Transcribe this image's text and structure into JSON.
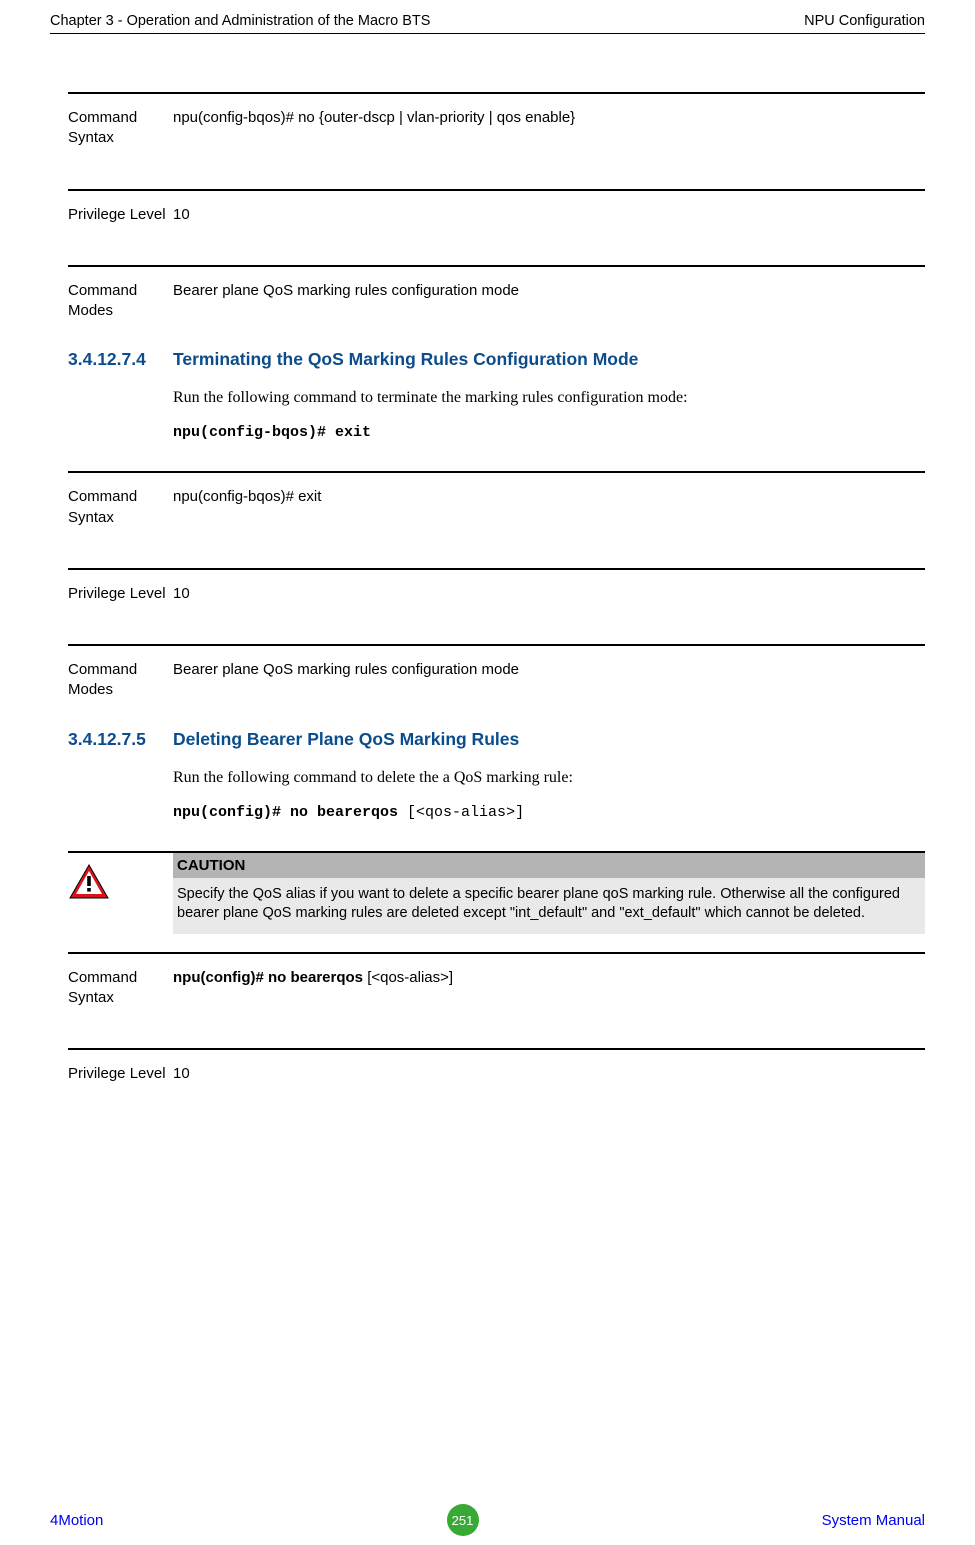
{
  "header": {
    "left": "Chapter 3 - Operation and Administration of the Macro BTS",
    "right": "NPU Configuration"
  },
  "block1": {
    "label": "Command Syntax",
    "value": "npu(config-bqos)# no {outer-dscp | vlan-priority | qos enable}"
  },
  "block2": {
    "label": "Privilege Level",
    "value": "10"
  },
  "block3": {
    "label": "Command Modes",
    "value": "Bearer plane QoS marking rules configuration mode"
  },
  "section1": {
    "num": "3.4.12.7.4",
    "title": "Terminating the QoS Marking Rules Configuration Mode",
    "body": "Run the following command to terminate the marking rules configuration mode:",
    "code": "npu(config-bqos)# exit"
  },
  "block4": {
    "label": "Command Syntax",
    "value": "npu(config-bqos)# exit"
  },
  "block5": {
    "label": "Privilege Level",
    "value": "10"
  },
  "block6": {
    "label": "Command Modes",
    "value": "Bearer plane QoS marking rules configuration mode"
  },
  "section2": {
    "num": "3.4.12.7.5",
    "title": "Deleting Bearer Plane QoS Marking Rules",
    "body": "Run the following command to delete the a QoS marking rule:",
    "code_bold": "npu(config)# no bearerqos ",
    "code_arg": "[<qos-alias>]"
  },
  "caution": {
    "title": "CAUTION",
    "body": "Specify the QoS alias if you want to delete a specific bearer plane qoS marking rule. Otherwise all the configured bearer plane QoS marking rules are deleted except \"int_default\" and \"ext_default\" which cannot be deleted."
  },
  "block7": {
    "label": "Command Syntax",
    "value_bold": "npu(config)# no bearerqos ",
    "value_plain": "[<qos-alias>]"
  },
  "block8": {
    "label": "Privilege Level",
    "value": "10"
  },
  "footer": {
    "left": "4Motion",
    "page": "251",
    "right": "System Manual"
  }
}
